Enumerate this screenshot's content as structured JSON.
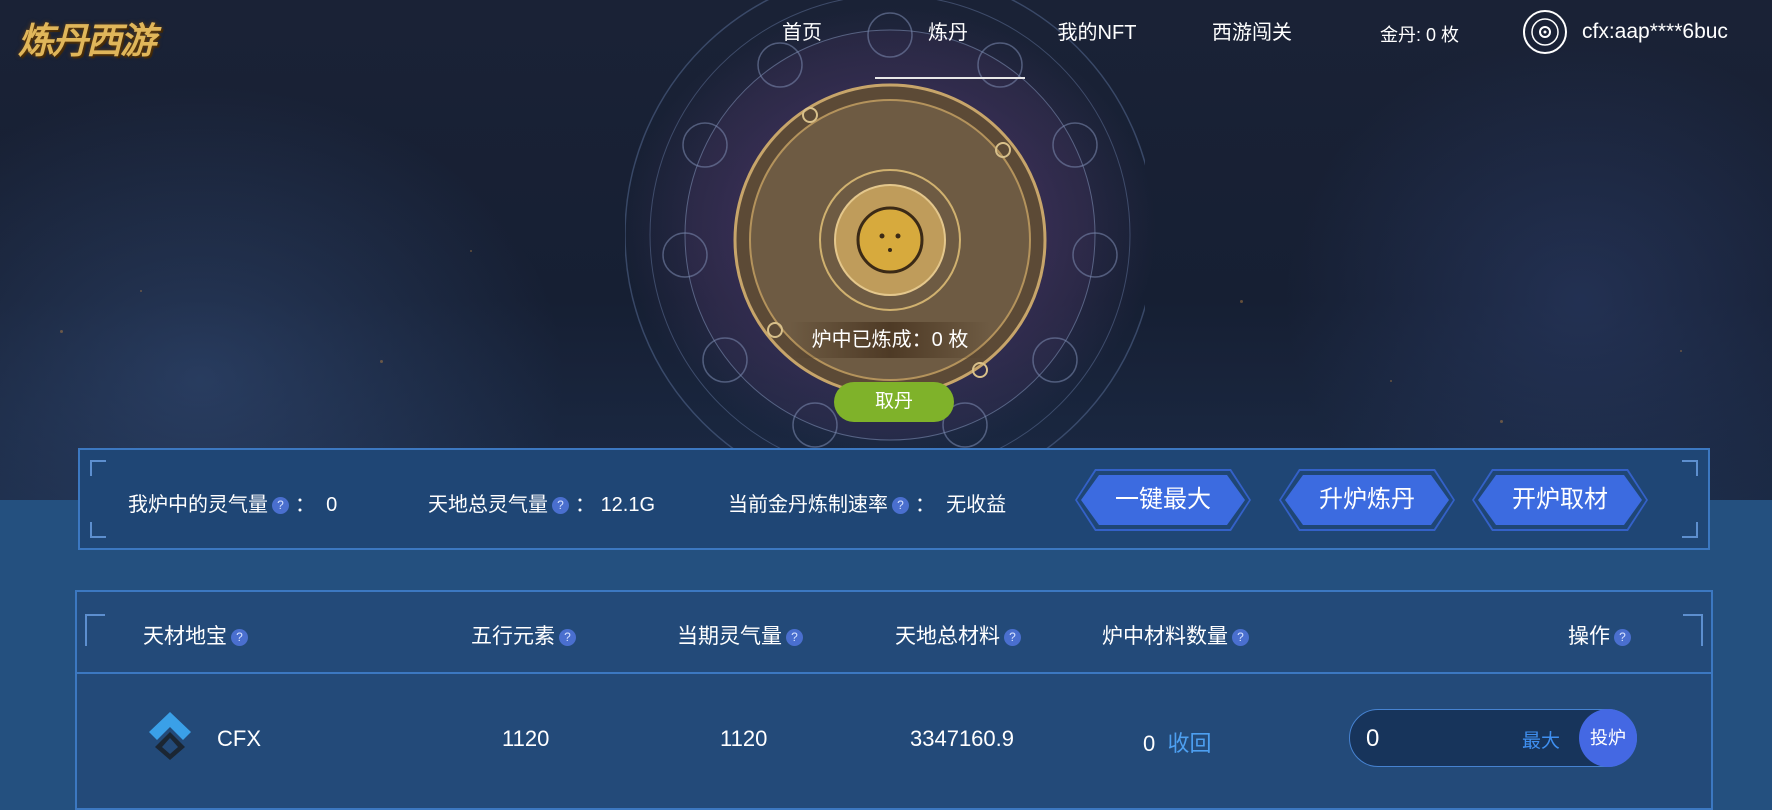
{
  "logo": {
    "text": "炼丹西游"
  },
  "nav": {
    "items": [
      {
        "label": "首页"
      },
      {
        "label": "炼丹"
      },
      {
        "label": "我的NFT"
      },
      {
        "label": "西游闯关"
      }
    ],
    "active": "炼丹"
  },
  "header": {
    "gold_label": "金丹:",
    "gold_value": "0 枚",
    "wallet_address": "cfx:aap****6buc"
  },
  "furnace": {
    "refined_text": "炉中已炼成：0 枚",
    "take_button": "取丹"
  },
  "stats": {
    "my_qi_label": "我炉中的灵气量",
    "my_qi_value": "0",
    "total_qi_label": "天地总灵气量",
    "total_qi_value": "12.1G",
    "rate_label": "当前金丹炼制速率",
    "rate_value": "无收益",
    "buttons": {
      "max": "一键最大",
      "upgrade": "升炉炼丹",
      "open": "开炉取材"
    }
  },
  "table": {
    "headers": [
      "天材地宝",
      "五行元素",
      "当期灵气量",
      "天地总材料",
      "炉中材料数量",
      "操作"
    ],
    "rows": [
      {
        "name": "CFX",
        "element": "1120",
        "qi": "1120",
        "total": "3347160.9",
        "in_furnace": "0",
        "recall": "收回",
        "input_value": "0",
        "max_label": "最大",
        "deposit_label": "投炉"
      }
    ]
  },
  "colors": {
    "accent_blue": "#3c6be0",
    "take_green": "#7fb22a",
    "gold": "#e0b65a",
    "link_blue": "#4d9ff0"
  },
  "icons": [
    "wallet-icon",
    "help-icon",
    "cfx-logo-icon"
  ]
}
